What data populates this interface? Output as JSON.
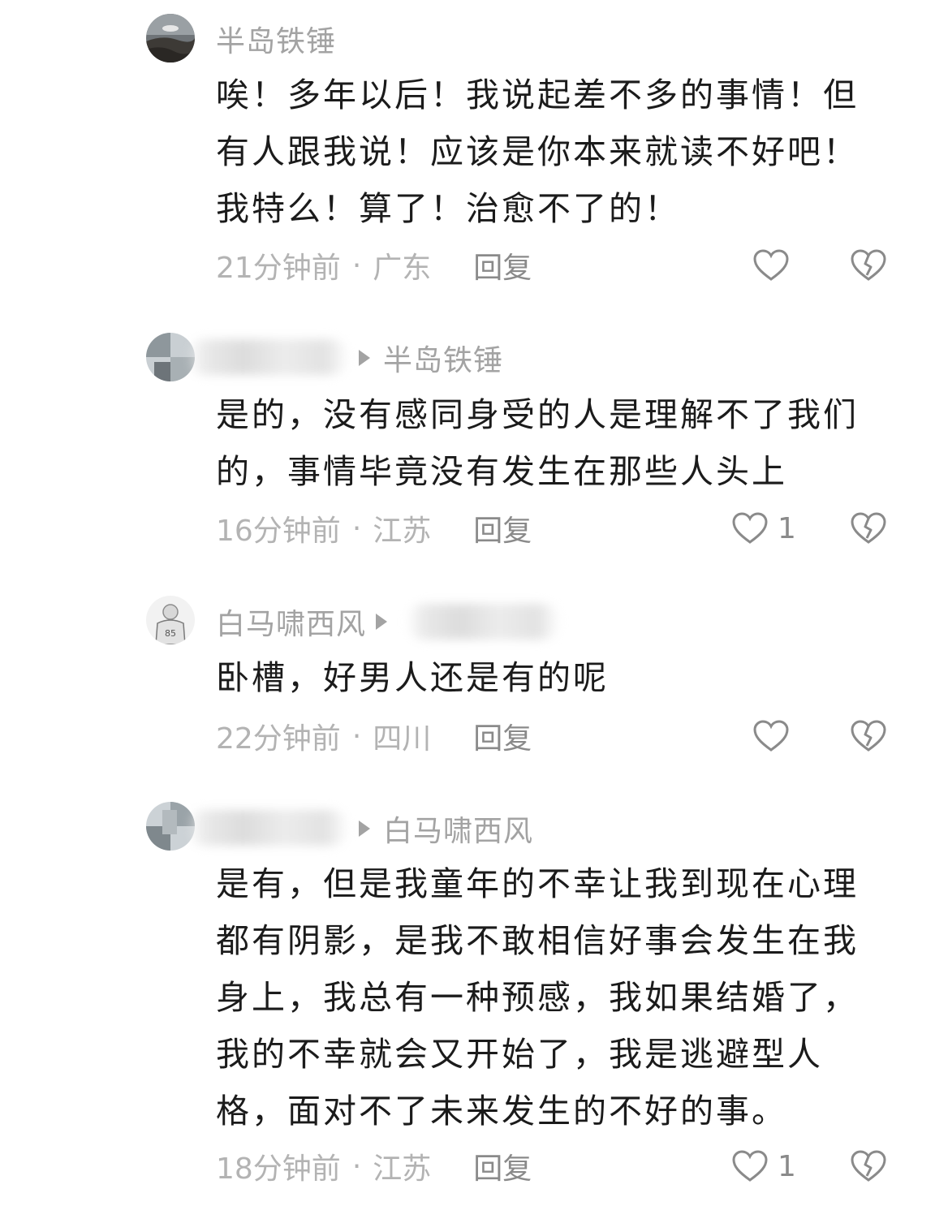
{
  "colors": {
    "username": "#a3a3a3",
    "body_text": "#1b1b1b",
    "meta_text": "#b3b3b3",
    "reply_text": "#8a8a8a",
    "icon": "#8a8a8a"
  },
  "comments": [
    {
      "username": "半岛铁锤",
      "reply_to": "",
      "text": "唉！多年以后！我说起差不多的事情！但\n有人跟我说！应该是你本来就读不好吧！\n我特么！算了！治愈不了的！",
      "time": "21分钟前",
      "location": "广东",
      "reply_label": "回复",
      "like_count": "",
      "avatar": "sea-rock-avatar"
    },
    {
      "username": "",
      "reply_to": "半岛铁锤",
      "text": "是的，没有感同身受的人是理解不了我们\n的，事情毕竟没有发生在那些人头上",
      "time": "16分钟前",
      "location": "江苏",
      "reply_label": "回复",
      "like_count": "1",
      "avatar": "blurred-avatar"
    },
    {
      "username": "白马啸西风",
      "reply_to": "",
      "text": "卧槽，好男人还是有的呢",
      "time": "22分钟前",
      "location": "四川",
      "reply_label": "回复",
      "like_count": "",
      "avatar": "jersey-avatar"
    },
    {
      "username": "",
      "reply_to": "白马啸西风",
      "text": "是有，但是我童年的不幸让我到现在心理\n都有阴影，是我不敢相信好事会发生在我\n身上，我总有一种预感，我如果结婚了，\n我的不幸就会又开始了，我是逃避型人\n格，面对不了未来发生的不好的事。",
      "time": "18分钟前",
      "location": "江苏",
      "reply_label": "回复",
      "like_count": "1",
      "avatar": "blurred-avatar"
    }
  ],
  "meta_separator": "·"
}
